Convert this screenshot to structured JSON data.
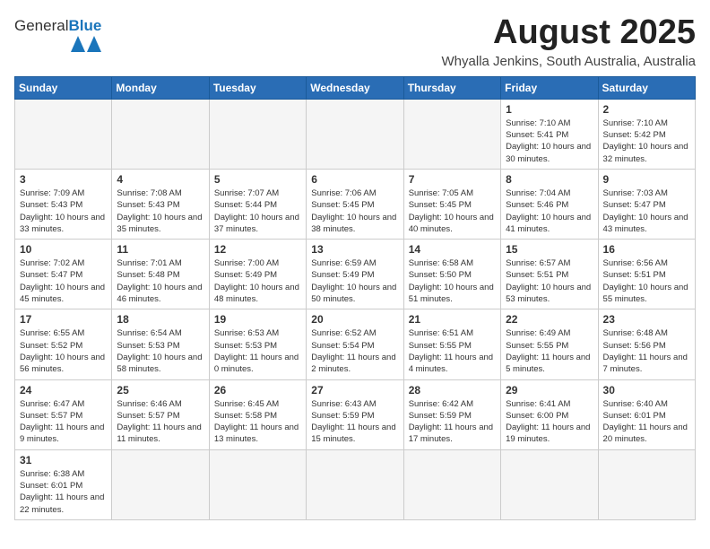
{
  "header": {
    "logo_general": "General",
    "logo_blue": "Blue",
    "month": "August 2025",
    "location": "Whyalla Jenkins, South Australia, Australia"
  },
  "weekdays": [
    "Sunday",
    "Monday",
    "Tuesday",
    "Wednesday",
    "Thursday",
    "Friday",
    "Saturday"
  ],
  "weeks": [
    [
      {
        "day": "",
        "info": ""
      },
      {
        "day": "",
        "info": ""
      },
      {
        "day": "",
        "info": ""
      },
      {
        "day": "",
        "info": ""
      },
      {
        "day": "",
        "info": ""
      },
      {
        "day": "1",
        "info": "Sunrise: 7:10 AM\nSunset: 5:41 PM\nDaylight: 10 hours\nand 30 minutes."
      },
      {
        "day": "2",
        "info": "Sunrise: 7:10 AM\nSunset: 5:42 PM\nDaylight: 10 hours\nand 32 minutes."
      }
    ],
    [
      {
        "day": "3",
        "info": "Sunrise: 7:09 AM\nSunset: 5:43 PM\nDaylight: 10 hours\nand 33 minutes."
      },
      {
        "day": "4",
        "info": "Sunrise: 7:08 AM\nSunset: 5:43 PM\nDaylight: 10 hours\nand 35 minutes."
      },
      {
        "day": "5",
        "info": "Sunrise: 7:07 AM\nSunset: 5:44 PM\nDaylight: 10 hours\nand 37 minutes."
      },
      {
        "day": "6",
        "info": "Sunrise: 7:06 AM\nSunset: 5:45 PM\nDaylight: 10 hours\nand 38 minutes."
      },
      {
        "day": "7",
        "info": "Sunrise: 7:05 AM\nSunset: 5:45 PM\nDaylight: 10 hours\nand 40 minutes."
      },
      {
        "day": "8",
        "info": "Sunrise: 7:04 AM\nSunset: 5:46 PM\nDaylight: 10 hours\nand 41 minutes."
      },
      {
        "day": "9",
        "info": "Sunrise: 7:03 AM\nSunset: 5:47 PM\nDaylight: 10 hours\nand 43 minutes."
      }
    ],
    [
      {
        "day": "10",
        "info": "Sunrise: 7:02 AM\nSunset: 5:47 PM\nDaylight: 10 hours\nand 45 minutes."
      },
      {
        "day": "11",
        "info": "Sunrise: 7:01 AM\nSunset: 5:48 PM\nDaylight: 10 hours\nand 46 minutes."
      },
      {
        "day": "12",
        "info": "Sunrise: 7:00 AM\nSunset: 5:49 PM\nDaylight: 10 hours\nand 48 minutes."
      },
      {
        "day": "13",
        "info": "Sunrise: 6:59 AM\nSunset: 5:49 PM\nDaylight: 10 hours\nand 50 minutes."
      },
      {
        "day": "14",
        "info": "Sunrise: 6:58 AM\nSunset: 5:50 PM\nDaylight: 10 hours\nand 51 minutes."
      },
      {
        "day": "15",
        "info": "Sunrise: 6:57 AM\nSunset: 5:51 PM\nDaylight: 10 hours\nand 53 minutes."
      },
      {
        "day": "16",
        "info": "Sunrise: 6:56 AM\nSunset: 5:51 PM\nDaylight: 10 hours\nand 55 minutes."
      }
    ],
    [
      {
        "day": "17",
        "info": "Sunrise: 6:55 AM\nSunset: 5:52 PM\nDaylight: 10 hours\nand 56 minutes."
      },
      {
        "day": "18",
        "info": "Sunrise: 6:54 AM\nSunset: 5:53 PM\nDaylight: 10 hours\nand 58 minutes."
      },
      {
        "day": "19",
        "info": "Sunrise: 6:53 AM\nSunset: 5:53 PM\nDaylight: 11 hours\nand 0 minutes."
      },
      {
        "day": "20",
        "info": "Sunrise: 6:52 AM\nSunset: 5:54 PM\nDaylight: 11 hours\nand 2 minutes."
      },
      {
        "day": "21",
        "info": "Sunrise: 6:51 AM\nSunset: 5:55 PM\nDaylight: 11 hours\nand 4 minutes."
      },
      {
        "day": "22",
        "info": "Sunrise: 6:49 AM\nSunset: 5:55 PM\nDaylight: 11 hours\nand 5 minutes."
      },
      {
        "day": "23",
        "info": "Sunrise: 6:48 AM\nSunset: 5:56 PM\nDaylight: 11 hours\nand 7 minutes."
      }
    ],
    [
      {
        "day": "24",
        "info": "Sunrise: 6:47 AM\nSunset: 5:57 PM\nDaylight: 11 hours\nand 9 minutes."
      },
      {
        "day": "25",
        "info": "Sunrise: 6:46 AM\nSunset: 5:57 PM\nDaylight: 11 hours\nand 11 minutes."
      },
      {
        "day": "26",
        "info": "Sunrise: 6:45 AM\nSunset: 5:58 PM\nDaylight: 11 hours\nand 13 minutes."
      },
      {
        "day": "27",
        "info": "Sunrise: 6:43 AM\nSunset: 5:59 PM\nDaylight: 11 hours\nand 15 minutes."
      },
      {
        "day": "28",
        "info": "Sunrise: 6:42 AM\nSunset: 5:59 PM\nDaylight: 11 hours\nand 17 minutes."
      },
      {
        "day": "29",
        "info": "Sunrise: 6:41 AM\nSunset: 6:00 PM\nDaylight: 11 hours\nand 19 minutes."
      },
      {
        "day": "30",
        "info": "Sunrise: 6:40 AM\nSunset: 6:01 PM\nDaylight: 11 hours\nand 20 minutes."
      }
    ],
    [
      {
        "day": "31",
        "info": "Sunrise: 6:38 AM\nSunset: 6:01 PM\nDaylight: 11 hours\nand 22 minutes."
      },
      {
        "day": "",
        "info": ""
      },
      {
        "day": "",
        "info": ""
      },
      {
        "day": "",
        "info": ""
      },
      {
        "day": "",
        "info": ""
      },
      {
        "day": "",
        "info": ""
      },
      {
        "day": "",
        "info": ""
      }
    ]
  ]
}
